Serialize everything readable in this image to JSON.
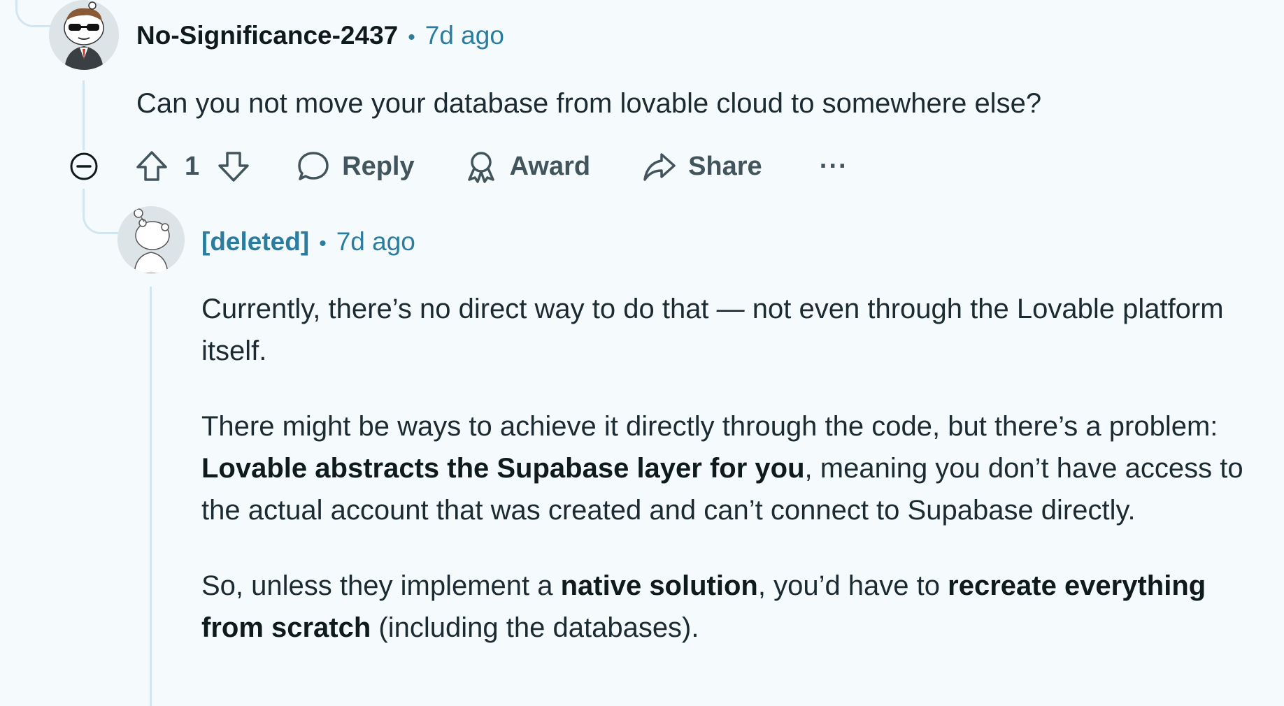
{
  "comment": {
    "author": "No-Significance-2437",
    "separator": "•",
    "time": "7d ago",
    "body": "Can you not move your database from lovable cloud to somewhere else?",
    "avatar_icon": "snoo-sunglasses-avatar-icon",
    "actions": {
      "upvote_icon": "upvote-arrow-icon",
      "vote_count": "1",
      "downvote_icon": "downvote-arrow-icon",
      "reply_icon": "speech-bubble-icon",
      "reply_label": "Reply",
      "award_icon": "award-ribbon-icon",
      "award_label": "Award",
      "share_icon": "share-arrow-icon",
      "share_label": "Share",
      "more_label": "···",
      "collapse_icon": "collapse-minus-icon"
    }
  },
  "reply": {
    "author": "[deleted]",
    "separator": "•",
    "time": "7d ago",
    "avatar_icon": "snoo-deleted-avatar-icon",
    "paragraphs": [
      [
        {
          "text": "Currently, there’s no direct way to do that — not even through the Lovable platform itself.",
          "bold": false
        }
      ],
      [
        {
          "text": "There might be ways to achieve it directly through the code, but there’s a problem: ",
          "bold": false
        },
        {
          "text": "Lovable abstracts the Supabase layer for you",
          "bold": true
        },
        {
          "text": ", meaning you don’t have access to the actual account that was created and can’t connect to Supabase directly.",
          "bold": false
        }
      ],
      [
        {
          "text": "So, unless they implement a ",
          "bold": false
        },
        {
          "text": "native solution",
          "bold": true
        },
        {
          "text": ", you’d have to ",
          "bold": false
        },
        {
          "text": "recreate everything from scratch",
          "bold": true
        },
        {
          "text": " (including the databases).",
          "bold": false
        }
      ]
    ]
  },
  "colors": {
    "background": "#f5fafd",
    "thread_line": "#d3e6ef",
    "accent_teal": "#2a7d9e",
    "action_gray": "#42555c",
    "text_dark": "#1c2b31"
  }
}
